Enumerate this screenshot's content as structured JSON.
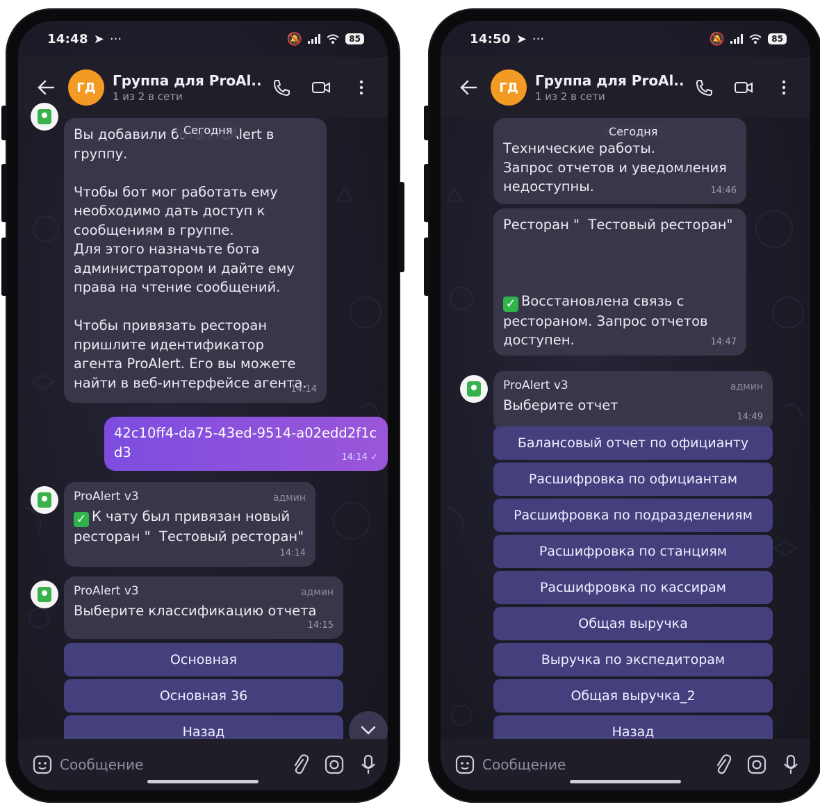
{
  "left": {
    "status": {
      "time": "14:48",
      "battery": "85"
    },
    "header": {
      "avatar": "ГД",
      "title": "Группа для ProAl...",
      "subtitle": "1 из 2 в сети"
    },
    "date_pill": "Сегодня",
    "msg1": {
      "text": "Вы добавили бота ProAlert в группу.\n\nЧтобы бот мог работать ему необходимо дать доступ к сообщениям в группе.\nДля этого назначьте бота администратором и дайте ему права на чтение сообщений.\n\nЧтобы привязать ресторан пришлите идентификатор агента ProAlert. Его вы можете найти в веб-интерфейсе агента.",
      "time": "14:14"
    },
    "msg_out": {
      "text": "42c10ff4-da75-43ed-9514-a02edd2f1cd3",
      "time": "14:14 ✓"
    },
    "msg2": {
      "sender": "ProAlert v3",
      "role": "админ",
      "text": "К чату был привязан новый ресторан \"  Тестовый ресторан\"",
      "time": "14:14"
    },
    "msg3": {
      "sender": "ProAlert v3",
      "role": "админ",
      "text": "Выберите классификацию отчета",
      "time": "14:15"
    },
    "buttons": [
      "Основная",
      "Основная 36",
      "Назад"
    ],
    "input_placeholder": "Сообщение"
  },
  "right": {
    "status": {
      "time": "14:50",
      "battery": "85"
    },
    "header": {
      "avatar": "ГД",
      "title": "Группа для ProAl...",
      "subtitle": "1 из 2 в сети"
    },
    "date_pill": "Сегодня",
    "msg1": {
      "text": "Технические работы.\nЗапрос отчетов и уведомления недоступны.",
      "time": "14:46"
    },
    "msg2": {
      "title": "Ресторан \"  Тестовый ресторан\"",
      "text": "Восстановлена связь с рестораном. Запрос отчетов доступен.",
      "time": "14:47"
    },
    "msg3": {
      "sender": "ProAlert v3",
      "role": "админ",
      "text": "Выберите отчет",
      "time": "14:49"
    },
    "buttons": [
      "Балансовый отчет по официанту",
      "Расшифровка по официантам",
      "Расшифровка по подразделениям",
      "Расшифровка по станциям",
      "Расшифровка по кассирам",
      "Общая выручка",
      "Выручка по экспедиторам",
      "Общая выручка_2",
      "Назад"
    ],
    "input_placeholder": "Сообщение"
  }
}
